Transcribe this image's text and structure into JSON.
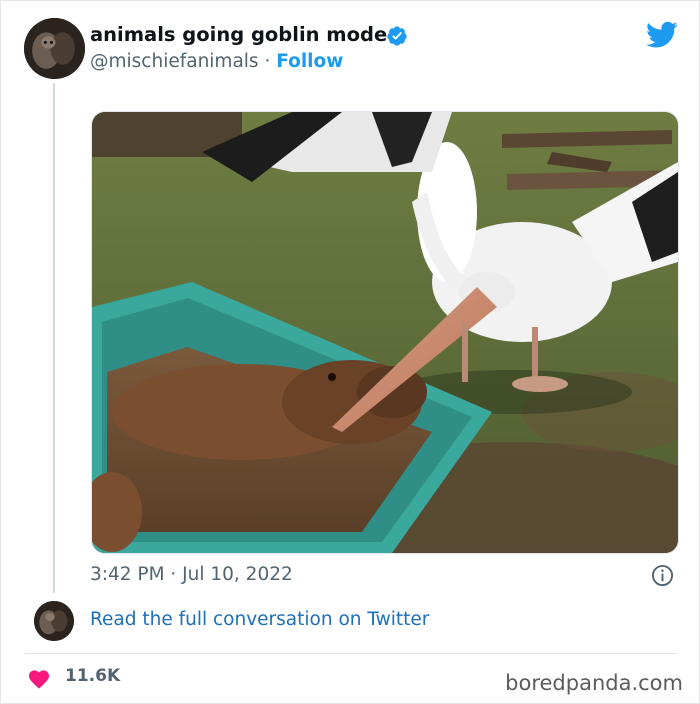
{
  "tweet": {
    "display_name": "animals going goblin mode",
    "handle": "@mischiefanimals",
    "separator": " · ",
    "follow_label": "Follow",
    "timestamp": "3:42 PM · Jul 10, 2022",
    "read_link": "Read the full conversation on Twitter",
    "likes": "11.6K"
  },
  "footer": {
    "watermark": "boredpanda.com"
  },
  "icons": {
    "verified": "verified-badge-icon",
    "twitter": "twitter-bird-icon",
    "info": "info-icon",
    "heart": "heart-icon"
  },
  "colors": {
    "link_blue": "#1d9bf0",
    "heart_pink": "#f91880",
    "muted_text": "#536471"
  }
}
